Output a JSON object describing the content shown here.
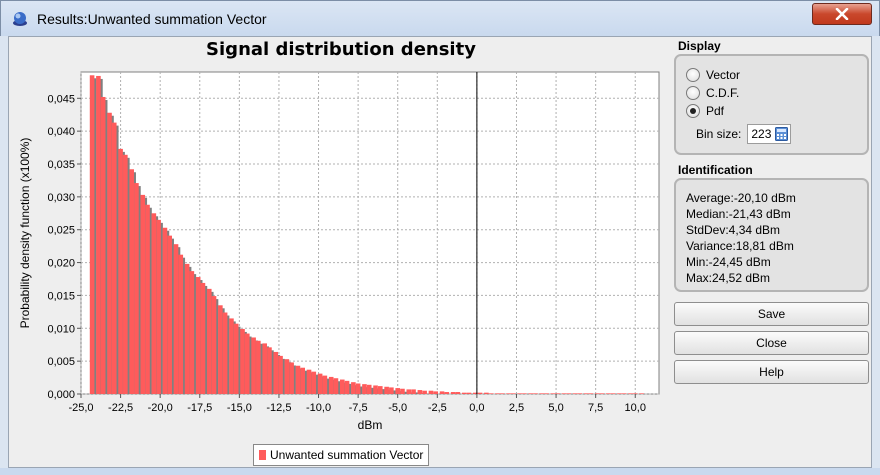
{
  "window": {
    "title": "Results:Unwanted summation Vector"
  },
  "chart_data": {
    "type": "bar",
    "title": "Signal distribution density",
    "xlabel": "dBm",
    "ylabel": "Probability density function (x100%)",
    "xlim": [
      -25.0,
      11.5
    ],
    "ylim": [
      0.0,
      0.049
    ],
    "x_ticks": [
      -25.0,
      -22.5,
      -20.0,
      -17.5,
      -15.0,
      -12.5,
      -10.0,
      -7.5,
      -5.0,
      -2.5,
      0.0,
      2.5,
      5.0,
      7.5,
      10.0
    ],
    "x_tick_labels": [
      "-25,0",
      "-22,5",
      "-20,0",
      "-17,5",
      "-15,0",
      "-12,5",
      "-10,0",
      "-7,5",
      "-5,0",
      "-2,5",
      "0,0",
      "2,5",
      "5,0",
      "7,5",
      "10,0"
    ],
    "y_ticks": [
      0.0,
      0.005,
      0.01,
      0.015,
      0.02,
      0.025,
      0.03,
      0.035,
      0.04,
      0.045
    ],
    "y_tick_labels": [
      "0,000",
      "0,005",
      "0,010",
      "0,015",
      "0,020",
      "0,025",
      "0,030",
      "0,035",
      "0,040",
      "0,045"
    ],
    "grid": true,
    "legend": "bottom",
    "bar_color": "#ff5b5b",
    "shadow_color": "#808080",
    "series": [
      {
        "name": "Unwanted summation Vector",
        "x": [
          -24.3,
          -23.9,
          -23.6,
          -23.2,
          -22.9,
          -22.5,
          -22.2,
          -21.8,
          -21.5,
          -21.1,
          -20.8,
          -20.4,
          -20.1,
          -19.7,
          -19.4,
          -19.0,
          -18.7,
          -18.3,
          -18.0,
          -17.6,
          -17.3,
          -16.9,
          -16.6,
          -16.2,
          -15.9,
          -15.5,
          -15.2,
          -14.8,
          -14.5,
          -14.1,
          -13.8,
          -13.4,
          -13.1,
          -12.7,
          -12.4,
          -12.0,
          -11.7,
          -11.3,
          -11.0,
          -10.6,
          -10.3,
          -9.9,
          -9.6,
          -9.2,
          -8.9,
          -8.5,
          -8.2,
          -7.8,
          -7.5,
          -7.1,
          -6.8,
          -6.4,
          -6.1,
          -5.7,
          -5.4,
          -5.0,
          -4.7,
          -4.3,
          -4.0,
          -3.6,
          -3.3,
          -2.9,
          -2.6,
          -2.2,
          -1.9,
          -1.5,
          -1.2,
          -0.8,
          -0.5,
          -0.1,
          0.2,
          0.6,
          0.9,
          1.3,
          1.6,
          2.0,
          2.3,
          2.7,
          3.0,
          3.4,
          3.7,
          4.1,
          4.4,
          4.8,
          5.1,
          5.5,
          5.8,
          6.2,
          6.5,
          6.9,
          7.2,
          7.6,
          7.9,
          8.3,
          8.6,
          9.0,
          9.3,
          9.7,
          10.0,
          10.4
        ],
        "values": [
          0.0485,
          0.0484,
          0.0452,
          0.0428,
          0.0413,
          0.0373,
          0.0364,
          0.0342,
          0.0321,
          0.0303,
          0.0288,
          0.0275,
          0.0265,
          0.0253,
          0.0241,
          0.0228,
          0.0212,
          0.0198,
          0.0187,
          0.0178,
          0.0169,
          0.016,
          0.0149,
          0.0135,
          0.0124,
          0.0115,
          0.0107,
          0.0099,
          0.0092,
          0.0086,
          0.0081,
          0.0077,
          0.0071,
          0.0064,
          0.0058,
          0.0053,
          0.0048,
          0.0043,
          0.004,
          0.0037,
          0.0034,
          0.0031,
          0.0028,
          0.0026,
          0.0024,
          0.0022,
          0.002,
          0.0018,
          0.0016,
          0.0015,
          0.0014,
          0.0013,
          0.0012,
          0.0011,
          0.001,
          0.0009,
          0.0008,
          0.0007,
          0.0007,
          0.0006,
          0.0005,
          0.0005,
          0.0004,
          0.0004,
          0.0003,
          0.0003,
          0.0003,
          0.0002,
          0.0002,
          0.0002,
          0.0002,
          0.0002,
          0.0001,
          0.0001,
          0.0001,
          0.0001,
          0.0001,
          0.0001,
          0.0001,
          0.0001,
          0.0001,
          0.0001,
          0.0001,
          0.0001,
          0.0001,
          0.0001,
          0.0001,
          0.0001,
          0.0001,
          0.0001,
          0.0001,
          0.0001,
          0.0001,
          0.0001,
          0.0001,
          0.0001,
          0.0001,
          0.0001,
          0.0001,
          0.0001
        ]
      }
    ]
  },
  "display": {
    "label": "Display",
    "options": [
      "Vector",
      "C.D.F.",
      "Pdf"
    ],
    "selected": "Pdf",
    "bin_size_label": "Bin size:",
    "bin_size_value": "223"
  },
  "identification": {
    "label": "Identification",
    "lines": [
      "Average:-20,10 dBm",
      "Median:-21,43 dBm",
      "StdDev:4,34 dBm",
      "Variance:18,81 dBm",
      "Min:-24,45 dBm",
      "Max:24,52 dBm"
    ]
  },
  "buttons": {
    "save": "Save",
    "close": "Close",
    "help": "Help"
  },
  "icons": {
    "app": "globe-icon",
    "close": "close-icon",
    "calc": "calculator-icon"
  }
}
